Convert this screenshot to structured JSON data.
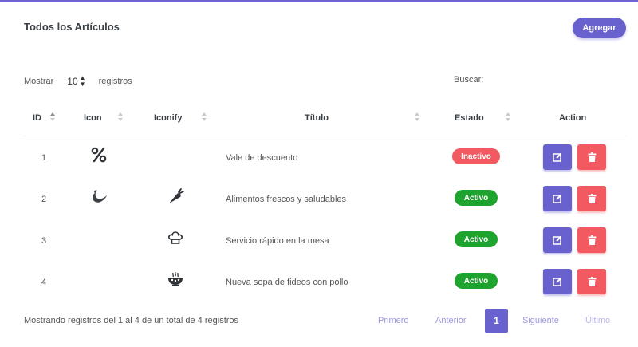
{
  "card": {
    "title": "Todos los Artículos",
    "add_label": "Agregar"
  },
  "length": {
    "prefix": "Mostrar",
    "value": "10",
    "suffix": "registros"
  },
  "search": {
    "label": "Buscar:"
  },
  "table": {
    "headers": {
      "id": "ID",
      "icon": "Icon",
      "iconify": "Iconify",
      "title": "Título",
      "status": "Estado",
      "action": "Action"
    },
    "rows": [
      {
        "id": "1",
        "icon": "percent-icon",
        "iconify": "",
        "title": "Vale de descuento",
        "status": "Inactivo"
      },
      {
        "id": "2",
        "icon": "leaf-swirl-icon",
        "iconify": "carrot-icon",
        "title": "Alimentos frescos y saludables",
        "status": "Activo"
      },
      {
        "id": "3",
        "icon": "",
        "iconify": "chef-hat-icon",
        "title": "Servicio rápido en la mesa",
        "status": "Activo"
      },
      {
        "id": "4",
        "icon": "",
        "iconify": "soup-bowl-icon",
        "title": "Nueva sopa de fideos con pollo",
        "status": "Activo"
      }
    ]
  },
  "footer": {
    "info": "Mostrando registros del 1 al 4 de un total de 4 registros",
    "pagination": {
      "first": "Primero",
      "prev": "Anterior",
      "current": "1",
      "next": "Siguiente",
      "last": "Último"
    }
  },
  "colors": {
    "primary": "#6861ce",
    "danger": "#f25961",
    "success": "#1fa32f"
  }
}
